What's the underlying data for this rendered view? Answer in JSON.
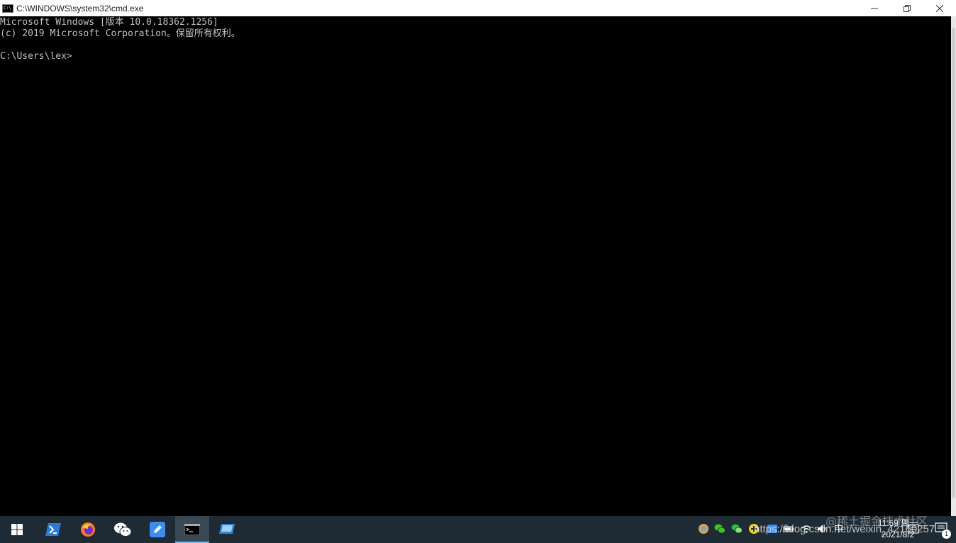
{
  "window": {
    "title": "C:\\WINDOWS\\system32\\cmd.exe",
    "icon_text": "C:\\",
    "controls": [
      "minimize-icon",
      "restore-icon",
      "close-icon"
    ]
  },
  "console": {
    "lines": [
      "Microsoft Windows [版本 10.0.18362.1256]",
      "(c) 2019 Microsoft Corporation。保留所有权利。",
      "",
      "C:\\Users\\lex>"
    ]
  },
  "taskbar": {
    "items": [
      {
        "name": "start-button",
        "icon": "windows-logo-icon",
        "active": false
      },
      {
        "name": "taskbar-powershell",
        "icon": "powershell-icon",
        "active": false
      },
      {
        "name": "taskbar-firefox",
        "icon": "firefox-icon",
        "active": false
      },
      {
        "name": "taskbar-wechat",
        "icon": "wechat-icon",
        "active": false
      },
      {
        "name": "taskbar-notes",
        "icon": "pen-note-icon",
        "active": false
      },
      {
        "name": "taskbar-cmd",
        "icon": "cmd-icon",
        "active": true
      },
      {
        "name": "taskbar-remote",
        "icon": "remote-desktop-icon",
        "active": false
      }
    ],
    "tray": {
      "ime": "中",
      "time": "11:59 周一",
      "date": "2021/8/2",
      "notification_count": "1"
    }
  },
  "watermarks": {
    "text": "@稀土掘金技术社区",
    "url": "https://blog.csdn.net/weixin_42160257"
  },
  "colors": {
    "taskbar_bg": "#1f2b34",
    "console_bg": "#000000",
    "console_fg": "#c0c0c0",
    "accent": "#76b9ed"
  }
}
